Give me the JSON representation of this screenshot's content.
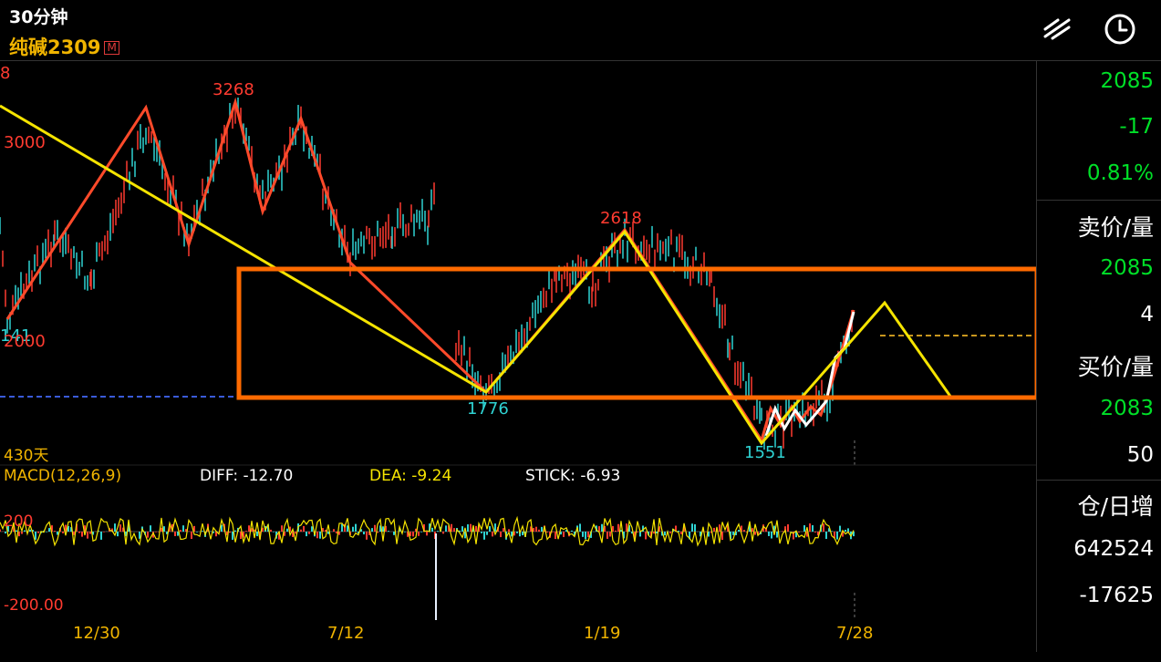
{
  "header": {
    "period": "30分钟",
    "contract": "纯碱2309",
    "badge": "M"
  },
  "toolbar": {
    "draw_icon": "draw-lines-icon",
    "clock_icon": "clock-icon"
  },
  "quote_panel": {
    "last_price": "2085",
    "change": "-17",
    "change_pct": "0.81%",
    "ask_title": "卖价/量",
    "ask_price": "2085",
    "ask_volume": "4",
    "bid_title": "买价/量",
    "bid_price": "2083",
    "bid_volume": "50",
    "oi_title": "仓/日增",
    "open_interest": "642524",
    "oi_change": "-17625"
  },
  "main_chart": {
    "price_labels": {
      "high_left": "3268",
      "high_mid": "2618",
      "low_mid": "1776",
      "low_right": "1551",
      "low_left": "141",
      "axis_3000": "3000",
      "axis_2000": "2000",
      "top_left_cut": "8"
    },
    "days_label": "430天"
  },
  "macd": {
    "title": "MACD(12,26,9)",
    "diff": "DIFF: -12.70",
    "dea": "DEA: -9.24",
    "stick": "STICK: -6.93",
    "axis_low": "-200.00",
    "axis_high": "200"
  },
  "x_axis": [
    "12/30",
    "7/12",
    "1/19",
    "7/28"
  ],
  "colors": {
    "up": "#ff3b30",
    "down": "#2fd3d3",
    "yellow": "#f5e400",
    "orange_box": "#ff6a00",
    "green": "#00e028",
    "label_orange": "#f0b400"
  }
}
